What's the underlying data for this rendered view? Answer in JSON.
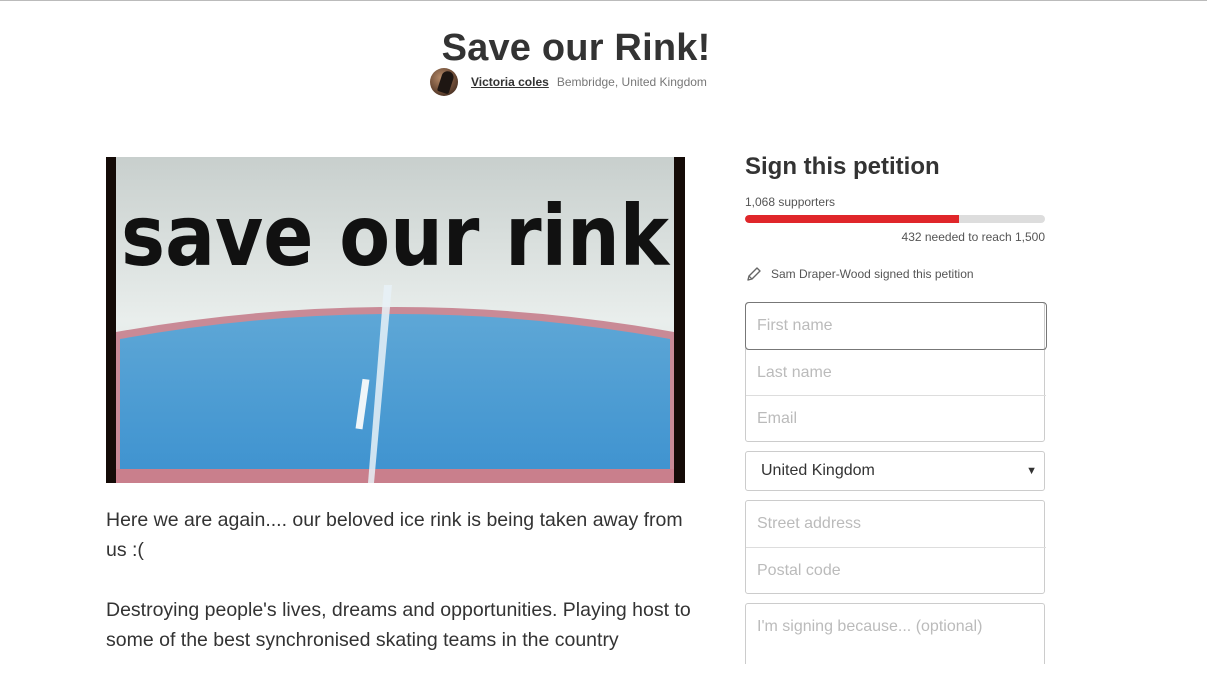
{
  "page": {
    "title": "Save our Rink!",
    "author": "Victoria coles",
    "location": "Bembridge, United Kingdom"
  },
  "hero_image": {
    "overlay_text": "save our rink"
  },
  "description": {
    "paragraphs": [
      "Here we are again.... our beloved ice rink is being taken away from us :(",
      "Destroying people's lives, dreams and opportunities. Playing host to some of the best synchronised skating teams in the country"
    ]
  },
  "petition": {
    "heading": "Sign this petition",
    "supporters_text": "1,068 supporters",
    "progress": 0.712,
    "needed_text": "432 needed to reach 1,500",
    "recent_signer_text": "Sam Draper-Wood signed this petition",
    "colors": {
      "progress": "#e0262a",
      "track": "#dddddd"
    },
    "form": {
      "first_name_placeholder": "First name",
      "last_name_placeholder": "Last name",
      "email_placeholder": "Email",
      "country_value": "United Kingdom",
      "street_placeholder": "Street address",
      "postal_placeholder": "Postal code",
      "reason_placeholder": "I'm signing because... (optional)"
    }
  },
  "icons": {
    "pencil": "pencil-icon",
    "dropdown": "chevron-down-icon"
  }
}
